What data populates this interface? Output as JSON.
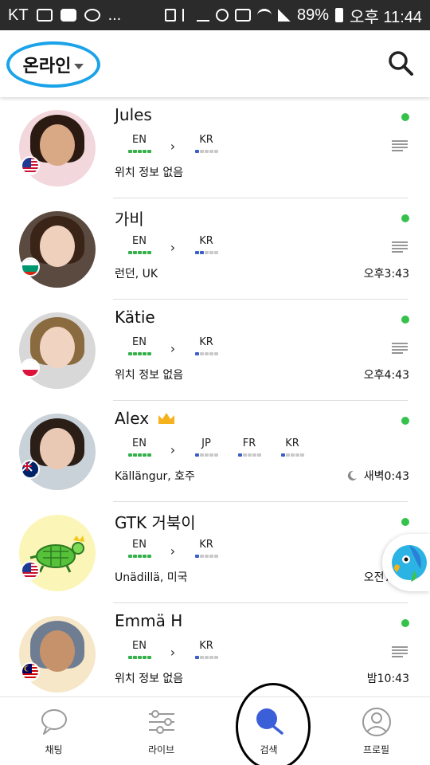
{
  "status_bar": {
    "carrier": "KT",
    "battery": "89%",
    "time": "오후 11:44",
    "more": "..."
  },
  "header": {
    "filter_label": "온라인",
    "search_icon": "search-icon"
  },
  "colors": {
    "online": "#35c24b",
    "level_native": "#35b04a",
    "level_learning": "#3a5fc8",
    "circle_highlight": "#1aa3e8"
  },
  "users": [
    {
      "name": "Jules",
      "country": "us",
      "native": [
        "EN"
      ],
      "learning": [
        "KR"
      ],
      "learning_levels": [
        1
      ],
      "location": "위치 정보 없음",
      "local_time": "",
      "has_crown": false,
      "online": true,
      "menu": true
    },
    {
      "name": "가비",
      "country": "bg",
      "native": [
        "EN"
      ],
      "learning": [
        "KR"
      ],
      "learning_levels": [
        2
      ],
      "location": "런던, UK",
      "local_time": "오후3:43",
      "has_crown": false,
      "online": true,
      "menu": true
    },
    {
      "name": "Kätie",
      "country": "pl",
      "native": [
        "EN"
      ],
      "learning": [
        "KR"
      ],
      "learning_levels": [
        1
      ],
      "location": "위치 정보 없음",
      "local_time": "오후4:43",
      "has_crown": false,
      "online": true,
      "menu": true
    },
    {
      "name": "Alex",
      "country": "au",
      "native": [
        "EN"
      ],
      "learning": [
        "JP",
        "FR",
        "KR"
      ],
      "learning_levels": [
        1,
        1,
        1
      ],
      "location": "Källängur, 호주",
      "local_time": "새벽0:43",
      "has_crown": true,
      "online": true,
      "menu": false
    },
    {
      "name": "GTK 거북이",
      "country": "us",
      "native": [
        "EN"
      ],
      "learning": [
        "KR"
      ],
      "learning_levels": [
        1
      ],
      "location": "Unädillä, 미국",
      "local_time": "오전7:43",
      "has_crown": false,
      "online": true,
      "menu": false
    },
    {
      "name": "Emmä H",
      "country": "my",
      "native": [
        "EN"
      ],
      "learning": [
        "KR"
      ],
      "learning_levels": [
        1
      ],
      "location": "위치 정보 없음",
      "local_time": "밤10:43",
      "has_crown": false,
      "online": true,
      "menu": true
    }
  ],
  "bottom_nav": [
    {
      "label": "채팅",
      "icon": "chat-icon",
      "active": false
    },
    {
      "label": "라이브",
      "icon": "sliders-icon",
      "active": false
    },
    {
      "label": "검색",
      "icon": "search-icon",
      "active": true
    },
    {
      "label": "프로필",
      "icon": "profile-icon",
      "active": false
    }
  ]
}
